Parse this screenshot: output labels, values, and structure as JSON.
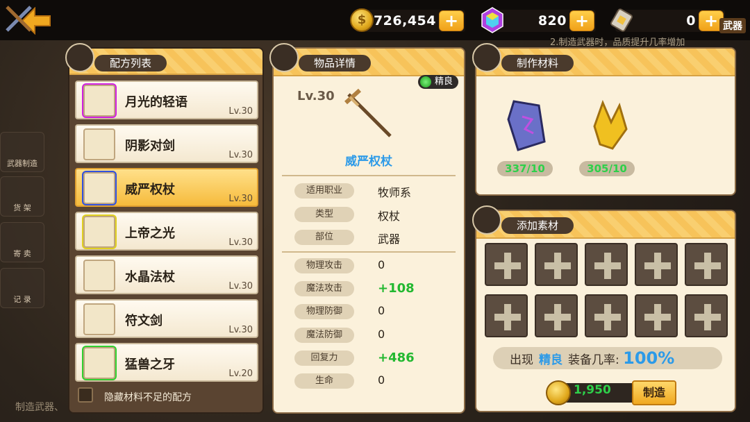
{
  "topbar": {
    "gold": "726,454",
    "gems": "820",
    "scrolls": "0",
    "plus": "+",
    "marquee": "2.制造武器时，品质提升几率增加"
  },
  "side_tabs": [
    {
      "label": "武器"
    },
    {
      "label": "武器制造"
    },
    {
      "label": "货 架"
    },
    {
      "label": "寄 卖"
    },
    {
      "label": "记 录"
    }
  ],
  "recipe_panel": {
    "title": "配方列表",
    "items": [
      {
        "name": "月光的轻语",
        "level": "Lv.30"
      },
      {
        "name": "阴影对剑",
        "level": "Lv.30"
      },
      {
        "name": "威严权杖",
        "level": "Lv.30"
      },
      {
        "name": "上帝之光",
        "level": "Lv.30"
      },
      {
        "name": "水晶法杖",
        "level": "Lv.30"
      },
      {
        "name": "符文剑",
        "level": "Lv.30"
      },
      {
        "name": "猛兽之牙",
        "level": "Lv.20"
      }
    ],
    "hide_label": "隐藏材料不足的配方"
  },
  "detail_panel": {
    "title": "物品详情",
    "quality": "精良",
    "level": "Lv.30",
    "item_name": "威严权杖",
    "info": [
      {
        "label": "适用职业",
        "value": "牧师系"
      },
      {
        "label": "类型",
        "value": "权杖"
      },
      {
        "label": "部位",
        "value": "武器"
      }
    ],
    "stats": [
      {
        "label": "物理攻击",
        "value": "0"
      },
      {
        "label": "魔法攻击",
        "value": "+108"
      },
      {
        "label": "物理防御",
        "value": "0"
      },
      {
        "label": "魔法防御",
        "value": "0"
      },
      {
        "label": "回复力",
        "value": "+486"
      },
      {
        "label": "生命",
        "value": "0"
      }
    ]
  },
  "materials_panel": {
    "title": "制作材料",
    "items": [
      {
        "count": "337/10"
      },
      {
        "count": "305/10"
      }
    ]
  },
  "add_panel": {
    "title": "添加素材",
    "rate_prefix": "出现",
    "rate_quality": "精良",
    "rate_mid": "装备几率:",
    "rate_value": "100%",
    "craft_price": "1,950",
    "craft_label": "制造"
  },
  "bottom_text": "制造武器、"
}
